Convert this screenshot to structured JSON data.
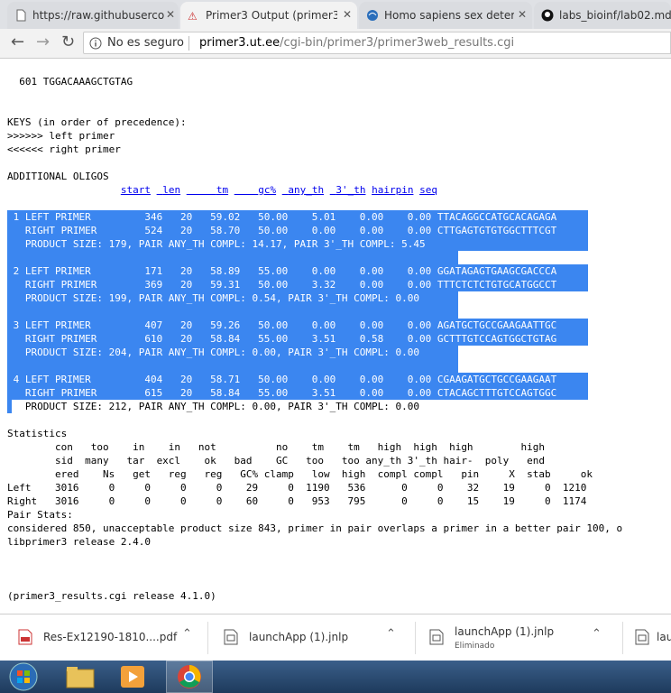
{
  "tabs": [
    {
      "title": "https://raw.githubuserco",
      "active": false
    },
    {
      "title": "Primer3 Output (primer3_",
      "active": true
    },
    {
      "title": "Homo sapiens sex detern",
      "active": false
    },
    {
      "title": "labs_bioinf/lab02.md at",
      "active": false
    }
  ],
  "toolbar": {
    "security": "No es seguro",
    "url_host": "primer3.ut.ee",
    "url_path": "/cgi-bin/primer3/primer3web_results.cgi"
  },
  "page": {
    "seq_line": "  601 TGGACAAAGCTGTAG",
    "keys_title": "KEYS (in order of precedence):",
    "key_left": ">>>>>> left primer",
    "key_right": "<<<<<< right primer",
    "additional_oligos": "ADDITIONAL OLIGOS",
    "header_pad": "                   ",
    "columns": [
      "start",
      "len",
      "tm",
      "gc%",
      "any_th",
      "3'_th",
      "hairpin",
      "seq"
    ],
    "oligo_rows": [
      " 1 LEFT PRIMER         346   20   59.02   50.00    5.01    0.00    0.00 TTACAGGCCATGCACAGAGA",
      "   RIGHT PRIMER        524   20   58.70   50.00    0.00    0.00    0.00 CTTGAGTGTGTGGCTTTCGT",
      "   PRODUCT SIZE: 179, PAIR ANY_TH COMPL: 14.17, PAIR 3'_TH COMPL: 5.45",
      "",
      " 2 LEFT PRIMER         171   20   58.89   55.00    0.00    0.00    0.00 GGATAGAGTGAAGCGACCCA",
      "   RIGHT PRIMER        369   20   59.31   50.00    3.32    0.00    0.00 TTTCTCTCTGTGCATGGCCT",
      "   PRODUCT SIZE: 199, PAIR ANY_TH COMPL: 0.54, PAIR 3'_TH COMPL: 0.00",
      "",
      " 3 LEFT PRIMER         407   20   59.26   50.00    0.00    0.00    0.00 AGATGCTGCCGAAGAATTGC",
      "   RIGHT PRIMER        610   20   58.84   55.00    3.51    0.58    0.00 GCTTTGTCCAGTGGCTGTAG",
      "   PRODUCT SIZE: 204, PAIR ANY_TH COMPL: 0.00, PAIR 3'_TH COMPL: 0.00",
      "",
      " 4 LEFT PRIMER         404   20   58.71   50.00    0.00    0.00    0.00 CGAAGATGCTGCCGAAGAAT",
      "   RIGHT PRIMER        615   20   58.84   55.00    3.51    0.00    0.00 CTACAGCTTTGTCCAGTGGC",
      "   PRODUCT SIZE: 212, PAIR ANY_TH COMPL: 0.00, PAIR 3'_TH COMPL: 0.00"
    ],
    "statistics_title": "Statistics",
    "stats_lines": [
      "        con   too    in    in   not          no    tm    tm   high  high  high        high",
      "        sid  many   tar  excl    ok   bad    GC   too   too any_th 3'_th hair-  poly   end",
      "        ered    Ns   get   reg   reg   GC% clamp   low  high  compl compl   pin     X  stab     ok",
      "Left    3016     0     0     0     0    29     0  1190   536      0     0    32    19     0  1210",
      "Right   3016     0     0     0     0    60     0   953   795      0     0    15    19     0  1174"
    ],
    "pair_stats": "Pair Stats:",
    "considered": "considered 850, unacceptable product size 843, primer in pair overlaps a primer in a better pair 100, o",
    "release": "libprimer3 release 2.4.0",
    "cgi_release": "(primer3_results.cgi release 4.1.0)"
  },
  "downloads": [
    {
      "name": "Res-Ex12190-1810....pdf",
      "sub": ""
    },
    {
      "name": "launchApp (1).jnlp",
      "sub": ""
    },
    {
      "name": "launchApp (1).jnlp",
      "sub": "Eliminado"
    },
    {
      "name": "lau",
      "sub": ""
    }
  ],
  "colors": {
    "selection": "#3b86f0",
    "tabstrip": "#dfe1e5"
  }
}
